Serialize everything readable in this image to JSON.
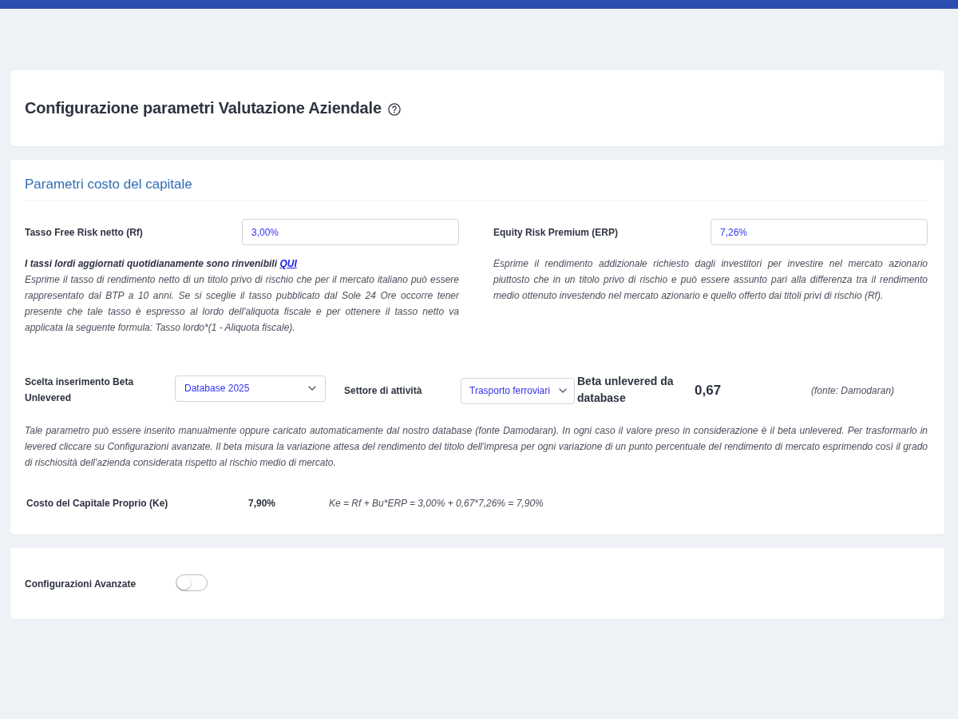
{
  "header": {
    "title": "Configurazione parametri Valutazione Aziendale"
  },
  "cost_of_capital": {
    "title": "Parametri costo del capitale",
    "fields": [
      {
        "label": "Tasso Free Risk netto (Rf)",
        "value": "3,00%",
        "note": {
          "text": "I tassi lordi aggiornati quotidianamente sono rinvenibili",
          "link": "QUI"
        },
        "description": "Esprime il tasso di rendimento netto di un titolo privo di rischio che per il mercato italiano può essere rappresentato dal BTP a 10 anni. Se si sceglie il tasso pubblicato dal Sole 24 Ore occorre tener presente che tale tasso è espresso al lordo dell'aliquota fiscale e per ottenere il tasso netto va applicata la seguente formula: Tasso lordo*(1 - Aliquota fiscale)."
      },
      {
        "label": "Equity Risk Premium (ERP)",
        "value": "7,26%",
        "description": "Esprime il rendimento addizionale richiesto dagli investitori per investire nel mercato azionario piuttosto che in un titolo privo di rischio e può essere assunto pari alla differenza tra il rendimento medio ottenuto investendo nel mercato azionario e quello offerto dai titoli privi di rischio (Rf)."
      }
    ],
    "beta": {
      "mode_label": "Scelta inserimento Beta Unlevered",
      "mode_value": "Database 2025",
      "sector_label": "Settore di attività",
      "sector_value": "Trasporto ferroviari",
      "db_label": "Beta unlevered da database",
      "db_value": "0,67",
      "source": "(fonte: Damodaran)",
      "description": "Tale parametro può essere inserito manualmente oppure caricato automaticamente dal nostro database (fonte Damodaran). In ogni caso il valore preso in considerazione è il beta unlevered. Per trasformarlo in levered cliccare su Configurazioni avanzate. Il beta misura la variazione attesa del rendimento del titolo dell'impresa per ogni variazione di un punto percentuale del rendimento di mercato esprimendo così il grado di rischiosità dell'azienda considerata rispetto al rischio medio di mercato."
    },
    "cost_of_equity": {
      "label": "Costo del Capitale Proprio (Ke)",
      "value": "7,90%",
      "formula": "Ke = Rf + Bu*ERP = 3,00% + 0,67*7,26% = 7,90%"
    }
  },
  "advanced": {
    "label": "Configurazioni Avanzate",
    "on": false
  }
}
